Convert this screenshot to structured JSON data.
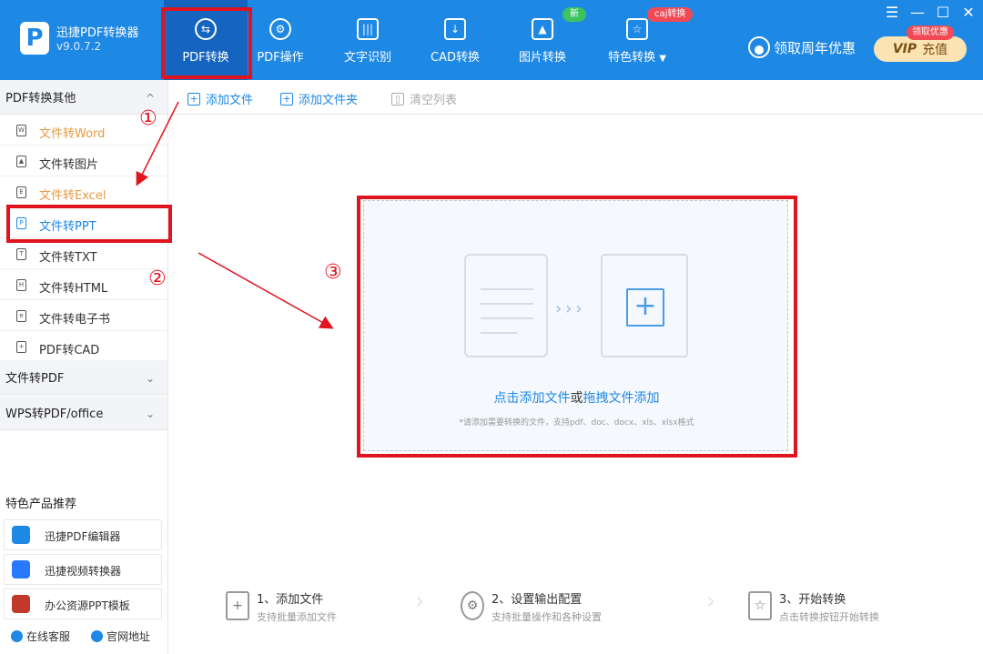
{
  "app": {
    "title": "迅捷PDF转换器",
    "version": "v9.0.7.2",
    "logo_letter": "P"
  },
  "tabs": [
    {
      "label": "PDF转换",
      "icon": "swap-icon",
      "active": true
    },
    {
      "label": "PDF操作",
      "icon": "gear-circle-icon"
    },
    {
      "label": "文字识别",
      "icon": "ocr-icon"
    },
    {
      "label": "CAD转换",
      "icon": "cad-icon"
    },
    {
      "label": "图片转换",
      "icon": "image-icon"
    },
    {
      "label": "特色转换",
      "icon": "star-swap-icon",
      "dropdown": "▼"
    }
  ],
  "badges": {
    "new": "新",
    "caj": "caj转换",
    "vip_promo": "领取优惠"
  },
  "window_controls": {
    "menu": "☰",
    "minimize": "—",
    "maximize": "☐",
    "close": "✕"
  },
  "header": {
    "promo_label": "领取周年优惠",
    "vip_tag": "VIP",
    "vip_label": "充值"
  },
  "sidebar": {
    "groups": [
      {
        "label": "PDF转换其他",
        "chevron": "^",
        "expanded": true
      },
      {
        "label": "文件转PDF",
        "chevron": "⌄"
      },
      {
        "label": "WPS转PDF/office",
        "chevron": "⌄"
      }
    ],
    "items": [
      {
        "label": "文件转Word",
        "icon_glyph": "W"
      },
      {
        "label": "文件转图片",
        "icon_glyph": "▲"
      },
      {
        "label": "文件转Excel",
        "icon_glyph": "E"
      },
      {
        "label": "文件转PPT",
        "icon_glyph": "P",
        "selected": true
      },
      {
        "label": "文件转TXT",
        "icon_glyph": "T"
      },
      {
        "label": "文件转HTML",
        "icon_glyph": "H"
      },
      {
        "label": "文件转电子书",
        "icon_glyph": "e"
      },
      {
        "label": "PDF转CAD",
        "icon_glyph": "+"
      }
    ],
    "recommend_title": "特色产品推荐",
    "recommend": [
      {
        "label": "迅捷PDF编辑器",
        "color": "#1e88e5"
      },
      {
        "label": "迅捷视频转换器",
        "color": "#2979ff"
      },
      {
        "label": "办公资源PPT模板",
        "color": "#c0392b"
      }
    ],
    "footer": {
      "service": "在线客服",
      "website": "官网地址"
    }
  },
  "toolbar": {
    "add_file": "添加文件",
    "add_folder": "添加文件夹",
    "clear_list": "清空列表",
    "add_file_icon": "+",
    "add_folder_icon": "+",
    "clear_icon": "▯"
  },
  "dropzone": {
    "click_add": "点击添加文件",
    "or": "或",
    "drag_add": "拖拽文件添加",
    "hint": "*请添加需要转换的文件，支持pdf、doc、docx、xls、xlsx格式",
    "arrows": "›››",
    "plus": "+"
  },
  "steps": [
    {
      "title": "1、添加文件",
      "sub": "支持批量添加文件",
      "icon_glyph": "+"
    },
    {
      "title": "2、设置输出配置",
      "sub": "支持批量操作和各种设置",
      "icon_glyph": "⚙"
    },
    {
      "title": "3、开始转换",
      "sub": "点击转换按钮开始转换",
      "icon_glyph": "☆"
    }
  ],
  "step_separator": "›",
  "annotations": {
    "one": "①",
    "two": "②",
    "three": "③"
  },
  "colors": {
    "brand": "#1e88e5",
    "active_tab": "#1565c0",
    "annotation_red": "#e0131e",
    "orange_item": "#e69a42"
  }
}
